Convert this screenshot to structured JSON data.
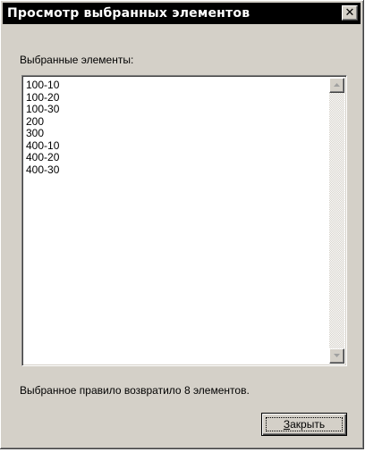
{
  "window": {
    "title": "Просмотр выбранных элементов",
    "close_glyph": "✕"
  },
  "list": {
    "label": "Выбранные элементы:",
    "items": [
      "100-10",
      "100-20",
      "100-30",
      "200",
      "300",
      "400-10",
      "400-20",
      "400-30"
    ]
  },
  "status": {
    "text": "Выбранное правило возвратило 8 элементов."
  },
  "buttons": {
    "close_mnemonic": "З",
    "close_rest": "акрыть"
  },
  "icons": {
    "scroll_up": "triangle-up-icon",
    "scroll_down": "triangle-down-icon"
  }
}
